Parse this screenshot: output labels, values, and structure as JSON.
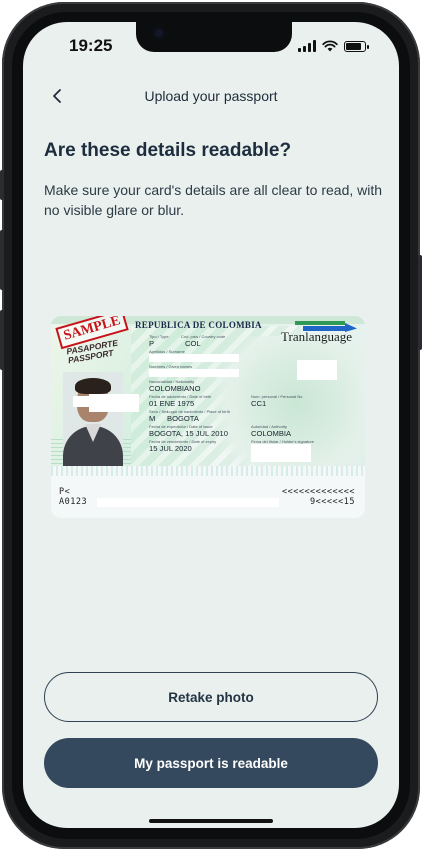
{
  "status_bar": {
    "time": "19:25",
    "signal_icon": "signal-icon",
    "wifi_icon": "wifi-icon",
    "battery_icon": "battery-icon"
  },
  "nav": {
    "back_icon": "chevron-left-icon",
    "title": "Upload your passport"
  },
  "content": {
    "heading": "Are these details readable?",
    "description": "Make sure your card's details are all clear to read, with no visible glare or blur."
  },
  "passport": {
    "sample_stamp": "SAMPLE",
    "sample_sub1": "PASAPORTE",
    "sample_sub2": "PASSPORT",
    "country_header": "REPUBLICA DE COLOMBIA",
    "overlay_text": "Tranlanguage",
    "type_label": "Tipo / Type",
    "type_value": "P",
    "country_code_label": "Cod. país / Country code",
    "country_code_value": "COL",
    "surname_label": "Apellidos / Surname",
    "given_label": "Nombres / Given names",
    "nationality_label": "Nacionalidad / Nationality",
    "nationality_value": "COLOMBIANO",
    "dob_label": "Fecha de nacimiento / Date of birth",
    "dob_value": "01 ENE 1975",
    "sex_label": "Sexo / Sex",
    "sex_value": "M",
    "pob_label": "Lugar de nacimiento / Place of birth",
    "pob_value": "BOGOTA",
    "personal_no_label": "Num. personal / Personal No",
    "personal_no_value": "CC1",
    "issue_label": "Fecha de expedición / Date of issue",
    "issue_value": "BOGOTA, 15 JUL 2010",
    "authority_label": "Autoridad / Authority",
    "authority_value": "COLOMBIA",
    "expiry_label": "Fecha de vencimiento / Date of expiry",
    "expiry_value": "15 JUL 2020",
    "signature_label": "Firma del titular / Holder's signature",
    "mrz_line1_left": "P<",
    "mrz_line1_right": "<<<<<<<<<<<<<",
    "mrz_line2_left": "A0123",
    "mrz_line2_right": "9<<<<<15"
  },
  "actions": {
    "retake_label": "Retake photo",
    "confirm_label": "My passport is readable"
  },
  "colors": {
    "background": "#e9f0ee",
    "primary": "#34495d",
    "text": "#1d2d3d",
    "stamp_red": "#c6141a"
  }
}
